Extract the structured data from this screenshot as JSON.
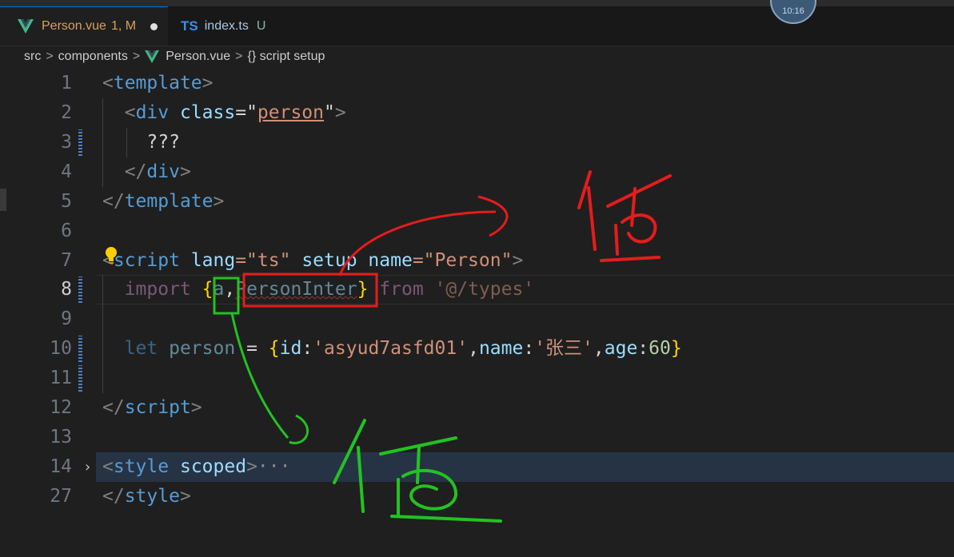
{
  "tabs": [
    {
      "name": "Person.vue",
      "status": "1, M",
      "dirty": true
    },
    {
      "icon": "TS",
      "name": "index.ts",
      "status": "U"
    }
  ],
  "avatar_text": "10:16",
  "breadcrumb": {
    "items": [
      "src",
      "components",
      "Person.vue",
      "{} script setup"
    ],
    "separator": ">"
  },
  "editor": {
    "line_numbers": [
      "1",
      "2",
      "3",
      "4",
      "5",
      "6",
      "7",
      "8",
      "9",
      "10",
      "11",
      "12",
      "13",
      "14",
      "27"
    ],
    "current_line": "8",
    "code": {
      "l1_open": "<",
      "l1_tag": "template",
      "l1_close": ">",
      "l2_open": "<",
      "l2_tag": "div",
      "l2_attr": "class",
      "l2_eq": "=\"",
      "l2_val": "person",
      "l2_q": "\"",
      "l2_close": ">",
      "l3_text": "???",
      "l4_open": "</",
      "l4_tag": "div",
      "l4_close": ">",
      "l5_open": "</",
      "l5_tag": "template",
      "l5_close": ">",
      "l7_open": "<",
      "l7_tag": "script",
      "l7_attr1": "lang",
      "l7_val1": "=\"ts\"",
      "l7_attr2": "setup",
      "l7_attr3": "name",
      "l7_val2": "=\"Person\"",
      "l7_close": ">",
      "l8_import": "import",
      "l8_lbrace": "{",
      "l8_a": "a",
      "l8_comma": ",",
      "l8_inter": "PersonInter",
      "l8_rbrace": "}",
      "l8_from": "from",
      "l8_path": "'@/types'",
      "l10_let": "let",
      "l10_person": "person",
      "l10_eq": "=",
      "l10_lbrace": "{",
      "l10_id": "id",
      "l10_idval": "'asyud7asfd01'",
      "l10_name": "name",
      "l10_nameval": "'张三'",
      "l10_age": "age",
      "l10_ageval": "60",
      "l10_rbrace": "}",
      "l12_open": "</",
      "l12_tag": "script",
      "l12_close": ">",
      "l14_open": "<",
      "l14_tag": "style",
      "l14_attr": "scoped",
      "l14_close": ">",
      "l14_ellipsis": "···",
      "l27_open": "</",
      "l27_tag": "style",
      "l27_close": ">"
    }
  },
  "annotations": {
    "red_label": "值",
    "green_label": "值",
    "red_color": "#e51c1c",
    "green_color": "#22c222"
  },
  "colors": {
    "background": "#1f1f1f",
    "tab_modified": "#d9a05a",
    "ts_icon": "#3b8eea",
    "error_squiggle": "#f14c4c"
  }
}
